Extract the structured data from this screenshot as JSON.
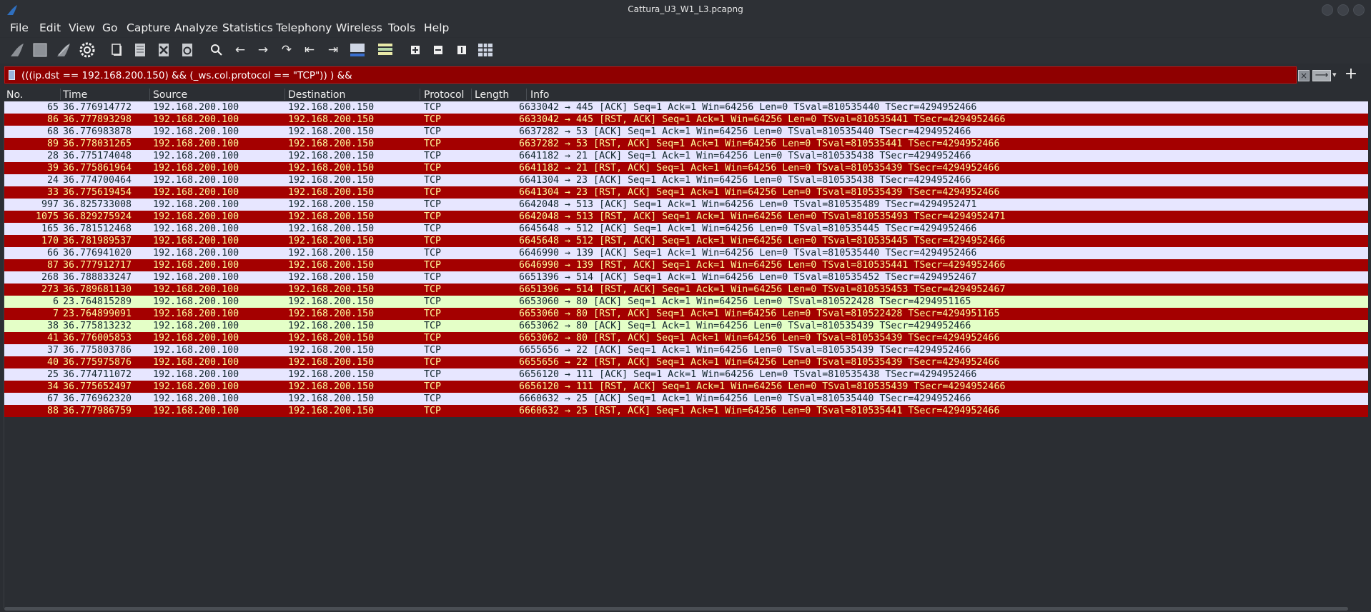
{
  "window": {
    "title": "Cattura_U3_W1_L3.pcapng"
  },
  "menu": [
    "File",
    "Edit",
    "View",
    "Go",
    "Capture",
    "Analyze",
    "Statistics",
    "Telephony",
    "Wireless",
    "Tools",
    "Help"
  ],
  "toolbar": {
    "icons": [
      "shark-fin-start-icon",
      "stop-capture-icon",
      "restart-capture-icon",
      "capture-options-gear-icon",
      "open-file-icon",
      "save-file-icon",
      "close-file-icon",
      "reload-file-icon",
      "find-packet-icon",
      "go-back-icon",
      "go-forward-icon",
      "go-to-packet-icon",
      "go-first-packet-icon",
      "go-last-packet-icon",
      "autoscroll-icon",
      "colorize-icon",
      "zoom-in-icon",
      "zoom-out-icon",
      "normal-size-icon",
      "resize-columns-icon"
    ]
  },
  "filter": {
    "text": "(((ip.dst == 192.168.200.150) && (_ws.col.protocol == \"TCP\")) ) &&",
    "clear_label": "×",
    "apply_label": "⟶",
    "dropdown_label": "▾",
    "add_label": "+"
  },
  "columns": [
    "No.",
    "Time",
    "Source",
    "Destination",
    "Protocol",
    "Length",
    "Info"
  ],
  "colors": {
    "rst_bg": "#a40000",
    "rst_fg": "#fffc9c",
    "ack_bg": "#e7e6ff",
    "ack_fg": "#12272e",
    "http_bg": "#e4ffc7",
    "http_fg": "#12272e"
  },
  "packets": [
    {
      "no": "65",
      "time": "36.776914772",
      "src": "192.168.200.100",
      "dst": "192.168.200.150",
      "proto": "TCP",
      "len": "66",
      "info": "33042 → 445 [ACK] Seq=1 Ack=1 Win=64256 Len=0 TSval=810535440 TSecr=4294952466",
      "style": "ack"
    },
    {
      "no": "86",
      "time": "36.777893298",
      "src": "192.168.200.100",
      "dst": "192.168.200.150",
      "proto": "TCP",
      "len": "66",
      "info": "33042 → 445 [RST, ACK] Seq=1 Ack=1 Win=64256 Len=0 TSval=810535441 TSecr=4294952466",
      "style": "rst"
    },
    {
      "no": "68",
      "time": "36.776983878",
      "src": "192.168.200.100",
      "dst": "192.168.200.150",
      "proto": "TCP",
      "len": "66",
      "info": "37282 → 53 [ACK] Seq=1 Ack=1 Win=64256 Len=0 TSval=810535440 TSecr=4294952466",
      "style": "ack"
    },
    {
      "no": "89",
      "time": "36.778031265",
      "src": "192.168.200.100",
      "dst": "192.168.200.150",
      "proto": "TCP",
      "len": "66",
      "info": "37282 → 53 [RST, ACK] Seq=1 Ack=1 Win=64256 Len=0 TSval=810535441 TSecr=4294952466",
      "style": "rst"
    },
    {
      "no": "28",
      "time": "36.775174048",
      "src": "192.168.200.100",
      "dst": "192.168.200.150",
      "proto": "TCP",
      "len": "66",
      "info": "41182 → 21 [ACK] Seq=1 Ack=1 Win=64256 Len=0 TSval=810535438 TSecr=4294952466",
      "style": "ack"
    },
    {
      "no": "39",
      "time": "36.775861964",
      "src": "192.168.200.100",
      "dst": "192.168.200.150",
      "proto": "TCP",
      "len": "66",
      "info": "41182 → 21 [RST, ACK] Seq=1 Ack=1 Win=64256 Len=0 TSval=810535439 TSecr=4294952466",
      "style": "rst"
    },
    {
      "no": "24",
      "time": "36.774700464",
      "src": "192.168.200.100",
      "dst": "192.168.200.150",
      "proto": "TCP",
      "len": "66",
      "info": "41304 → 23 [ACK] Seq=1 Ack=1 Win=64256 Len=0 TSval=810535438 TSecr=4294952466",
      "style": "ack"
    },
    {
      "no": "33",
      "time": "36.775619454",
      "src": "192.168.200.100",
      "dst": "192.168.200.150",
      "proto": "TCP",
      "len": "66",
      "info": "41304 → 23 [RST, ACK] Seq=1 Ack=1 Win=64256 Len=0 TSval=810535439 TSecr=4294952466",
      "style": "rst"
    },
    {
      "no": "997",
      "time": "36.825733008",
      "src": "192.168.200.100",
      "dst": "192.168.200.150",
      "proto": "TCP",
      "len": "66",
      "info": "42048 → 513 [ACK] Seq=1 Ack=1 Win=64256 Len=0 TSval=810535489 TSecr=4294952471",
      "style": "ack"
    },
    {
      "no": "1075",
      "time": "36.829275924",
      "src": "192.168.200.100",
      "dst": "192.168.200.150",
      "proto": "TCP",
      "len": "66",
      "info": "42048 → 513 [RST, ACK] Seq=1 Ack=1 Win=64256 Len=0 TSval=810535493 TSecr=4294952471",
      "style": "rst"
    },
    {
      "no": "165",
      "time": "36.781512468",
      "src": "192.168.200.100",
      "dst": "192.168.200.150",
      "proto": "TCP",
      "len": "66",
      "info": "45648 → 512 [ACK] Seq=1 Ack=1 Win=64256 Len=0 TSval=810535445 TSecr=4294952466",
      "style": "ack"
    },
    {
      "no": "170",
      "time": "36.781989537",
      "src": "192.168.200.100",
      "dst": "192.168.200.150",
      "proto": "TCP",
      "len": "66",
      "info": "45648 → 512 [RST, ACK] Seq=1 Ack=1 Win=64256 Len=0 TSval=810535445 TSecr=4294952466",
      "style": "rst"
    },
    {
      "no": "66",
      "time": "36.776941020",
      "src": "192.168.200.100",
      "dst": "192.168.200.150",
      "proto": "TCP",
      "len": "66",
      "info": "46990 → 139 [ACK] Seq=1 Ack=1 Win=64256 Len=0 TSval=810535440 TSecr=4294952466",
      "style": "ack"
    },
    {
      "no": "87",
      "time": "36.777912717",
      "src": "192.168.200.100",
      "dst": "192.168.200.150",
      "proto": "TCP",
      "len": "66",
      "info": "46990 → 139 [RST, ACK] Seq=1 Ack=1 Win=64256 Len=0 TSval=810535441 TSecr=4294952466",
      "style": "rst"
    },
    {
      "no": "268",
      "time": "36.788833247",
      "src": "192.168.200.100",
      "dst": "192.168.200.150",
      "proto": "TCP",
      "len": "66",
      "info": "51396 → 514 [ACK] Seq=1 Ack=1 Win=64256 Len=0 TSval=810535452 TSecr=4294952467",
      "style": "ack"
    },
    {
      "no": "273",
      "time": "36.789681130",
      "src": "192.168.200.100",
      "dst": "192.168.200.150",
      "proto": "TCP",
      "len": "66",
      "info": "51396 → 514 [RST, ACK] Seq=1 Ack=1 Win=64256 Len=0 TSval=810535453 TSecr=4294952467",
      "style": "rst"
    },
    {
      "no": "6",
      "time": "23.764815289",
      "src": "192.168.200.100",
      "dst": "192.168.200.150",
      "proto": "TCP",
      "len": "66",
      "info": "53060 → 80 [ACK] Seq=1 Ack=1 Win=64256 Len=0 TSval=810522428 TSecr=4294951165",
      "style": "http"
    },
    {
      "no": "7",
      "time": "23.764899091",
      "src": "192.168.200.100",
      "dst": "192.168.200.150",
      "proto": "TCP",
      "len": "66",
      "info": "53060 → 80 [RST, ACK] Seq=1 Ack=1 Win=64256 Len=0 TSval=810522428 TSecr=4294951165",
      "style": "rst"
    },
    {
      "no": "38",
      "time": "36.775813232",
      "src": "192.168.200.100",
      "dst": "192.168.200.150",
      "proto": "TCP",
      "len": "66",
      "info": "53062 → 80 [ACK] Seq=1 Ack=1 Win=64256 Len=0 TSval=810535439 TSecr=4294952466",
      "style": "http"
    },
    {
      "no": "41",
      "time": "36.776005853",
      "src": "192.168.200.100",
      "dst": "192.168.200.150",
      "proto": "TCP",
      "len": "66",
      "info": "53062 → 80 [RST, ACK] Seq=1 Ack=1 Win=64256 Len=0 TSval=810535439 TSecr=4294952466",
      "style": "rst"
    },
    {
      "no": "37",
      "time": "36.775803786",
      "src": "192.168.200.100",
      "dst": "192.168.200.150",
      "proto": "TCP",
      "len": "66",
      "info": "55656 → 22 [ACK] Seq=1 Ack=1 Win=64256 Len=0 TSval=810535439 TSecr=4294952466",
      "style": "ack"
    },
    {
      "no": "40",
      "time": "36.775975876",
      "src": "192.168.200.100",
      "dst": "192.168.200.150",
      "proto": "TCP",
      "len": "66",
      "info": "55656 → 22 [RST, ACK] Seq=1 Ack=1 Win=64256 Len=0 TSval=810535439 TSecr=4294952466",
      "style": "rst"
    },
    {
      "no": "25",
      "time": "36.774711072",
      "src": "192.168.200.100",
      "dst": "192.168.200.150",
      "proto": "TCP",
      "len": "66",
      "info": "56120 → 111 [ACK] Seq=1 Ack=1 Win=64256 Len=0 TSval=810535438 TSecr=4294952466",
      "style": "ack"
    },
    {
      "no": "34",
      "time": "36.775652497",
      "src": "192.168.200.100",
      "dst": "192.168.200.150",
      "proto": "TCP",
      "len": "66",
      "info": "56120 → 111 [RST, ACK] Seq=1 Ack=1 Win=64256 Len=0 TSval=810535439 TSecr=4294952466",
      "style": "rst"
    },
    {
      "no": "67",
      "time": "36.776962320",
      "src": "192.168.200.100",
      "dst": "192.168.200.150",
      "proto": "TCP",
      "len": "66",
      "info": "60632 → 25 [ACK] Seq=1 Ack=1 Win=64256 Len=0 TSval=810535440 TSecr=4294952466",
      "style": "ack"
    },
    {
      "no": "88",
      "time": "36.777986759",
      "src": "192.168.200.100",
      "dst": "192.168.200.150",
      "proto": "TCP",
      "len": "66",
      "info": "60632 → 25 [RST, ACK] Seq=1 Ack=1 Win=64256 Len=0 TSval=810535441 TSecr=4294952466",
      "style": "rst"
    }
  ]
}
